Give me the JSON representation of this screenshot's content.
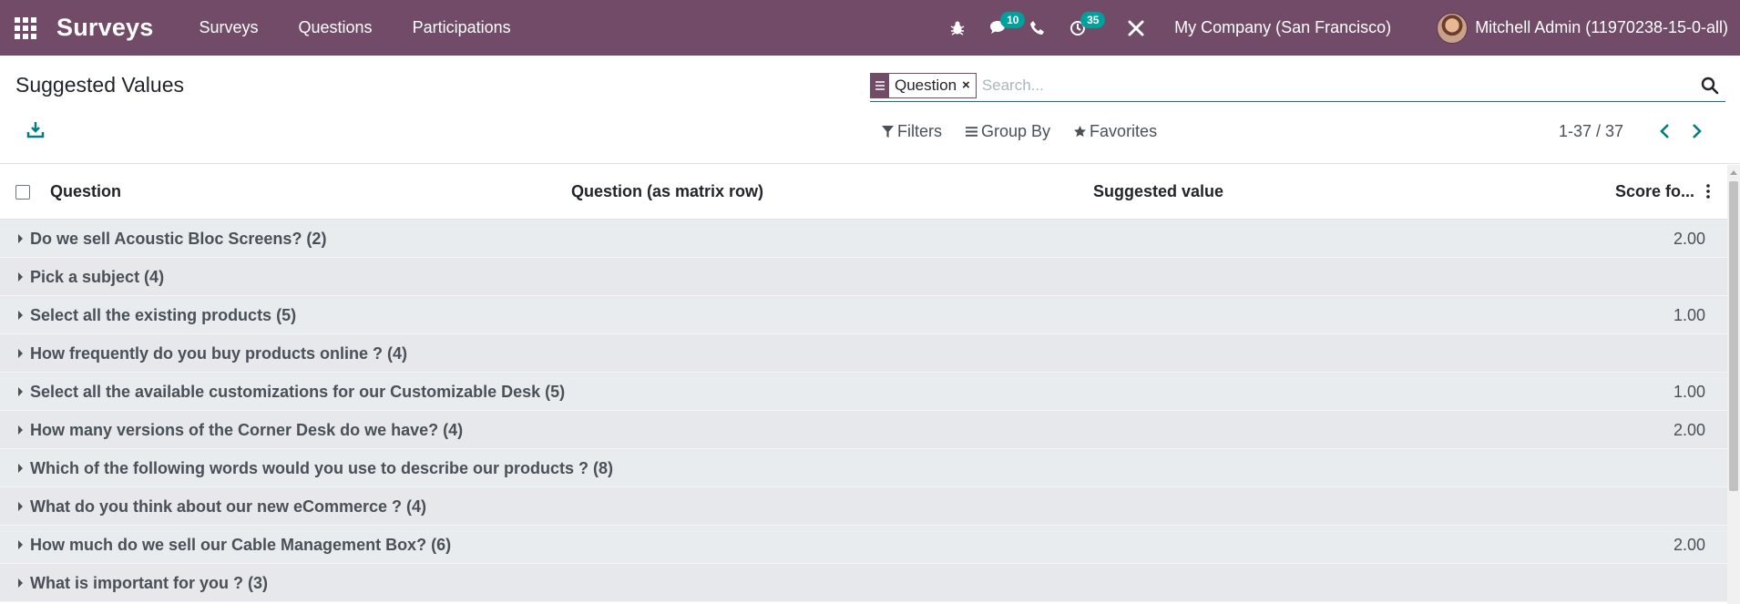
{
  "navbar": {
    "app_name": "Surveys",
    "menu": [
      "Surveys",
      "Questions",
      "Participations"
    ],
    "messages_count": "10",
    "activities_count": "35",
    "company": "My Company (San Francisco)",
    "user": "Mitchell Admin (11970238-15-0-all)",
    "background_color": "#714b67"
  },
  "control_panel": {
    "title": "Suggested Values",
    "search": {
      "facet_label": "Question",
      "placeholder": "Search..."
    },
    "filters_label": "Filters",
    "group_by_label": "Group By",
    "favorites_label": "Favorites",
    "pager": "1-37 / 37"
  },
  "list": {
    "columns": [
      "Question",
      "Question (as matrix row)",
      "Suggested value",
      "Score fo..."
    ],
    "groups": [
      {
        "name": "Do we sell Acoustic Bloc Screens? (2)",
        "score": "2.00"
      },
      {
        "name": "Pick a subject (4)",
        "score": ""
      },
      {
        "name": "Select all the existing products (5)",
        "score": "1.00"
      },
      {
        "name": "How frequently do you buy products online ? (4)",
        "score": ""
      },
      {
        "name": "Select all the available customizations for our Customizable Desk (5)",
        "score": "1.00"
      },
      {
        "name": "How many versions of the Corner Desk do we have? (4)",
        "score": "2.00"
      },
      {
        "name": "Which of the following words would you use to describe our products ? (8)",
        "score": ""
      },
      {
        "name": "What do you think about our new eCommerce ? (4)",
        "score": ""
      },
      {
        "name": "How much do we sell our Cable Management Box? (6)",
        "score": "2.00"
      },
      {
        "name": "What is important for you ? (3)",
        "score": ""
      }
    ]
  }
}
